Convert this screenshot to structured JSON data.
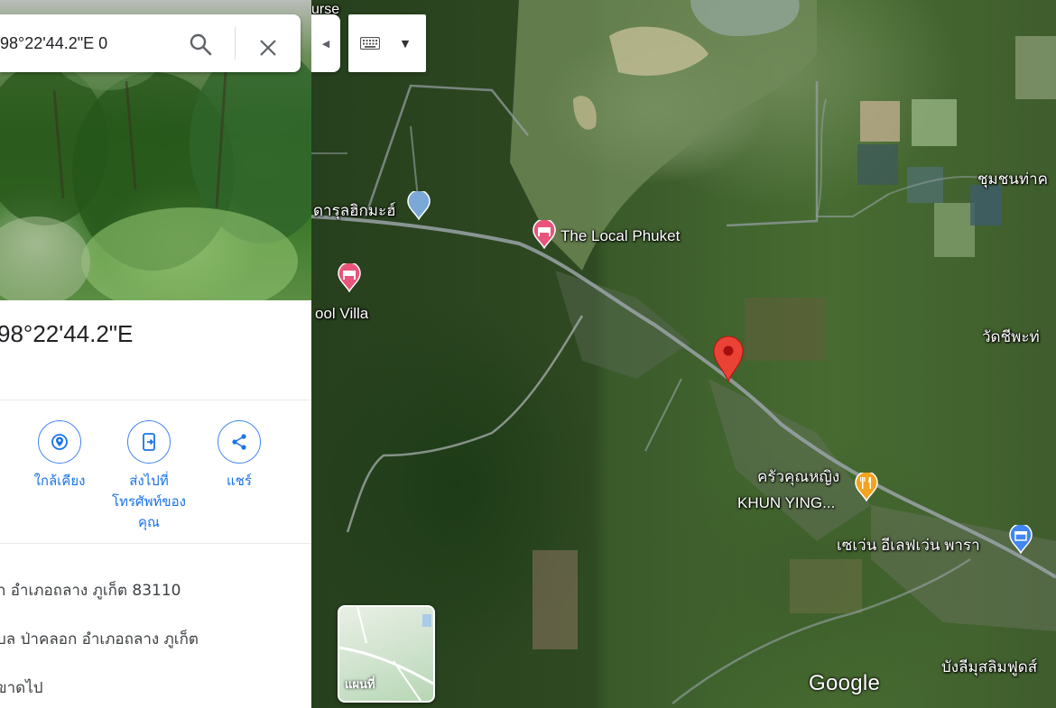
{
  "search": {
    "value": "98°22'44.2\"E 0"
  },
  "place": {
    "coordinates": "98°22'44.2\"E"
  },
  "actions": [
    {
      "label": "ใกล้เคียง"
    },
    {
      "label": "ส่งไปที่\nโทรศัพท์ของ\nคุณ"
    },
    {
      "label": "แชร์"
    }
  ],
  "info_rows": [
    "ก อำเภอถลาง ภูเก็ต 83110",
    "บล ป่าคลอก อำเภอถลาง ภูเก็ต",
    "ขาดไป"
  ],
  "map": {
    "top_fragment": "urse",
    "pois": {
      "mosque": "ดารุลฮิกมะฮ์",
      "hotel1": "The Local Phuket",
      "hotel2": "ool Villa",
      "restaurant_th": "ครัวคุณหญิง",
      "restaurant_en": "KHUN YING...",
      "store": "เซเว่น อีเลฟเว่น พารา",
      "community": "ชุมชนท่าค",
      "temple": "วัดชีพะท่",
      "shop": "บังลีมุสลิมฟูดส์"
    },
    "layer_toggle": "แผนที่",
    "logo": "Google",
    "colors": {
      "hotel_pin": "#e8547a",
      "place_pin": "#ea4335",
      "restaurant_pin": "#f4a21f",
      "store_pin": "#4285f4",
      "mosque_pin": "#7aa9d8"
    }
  }
}
